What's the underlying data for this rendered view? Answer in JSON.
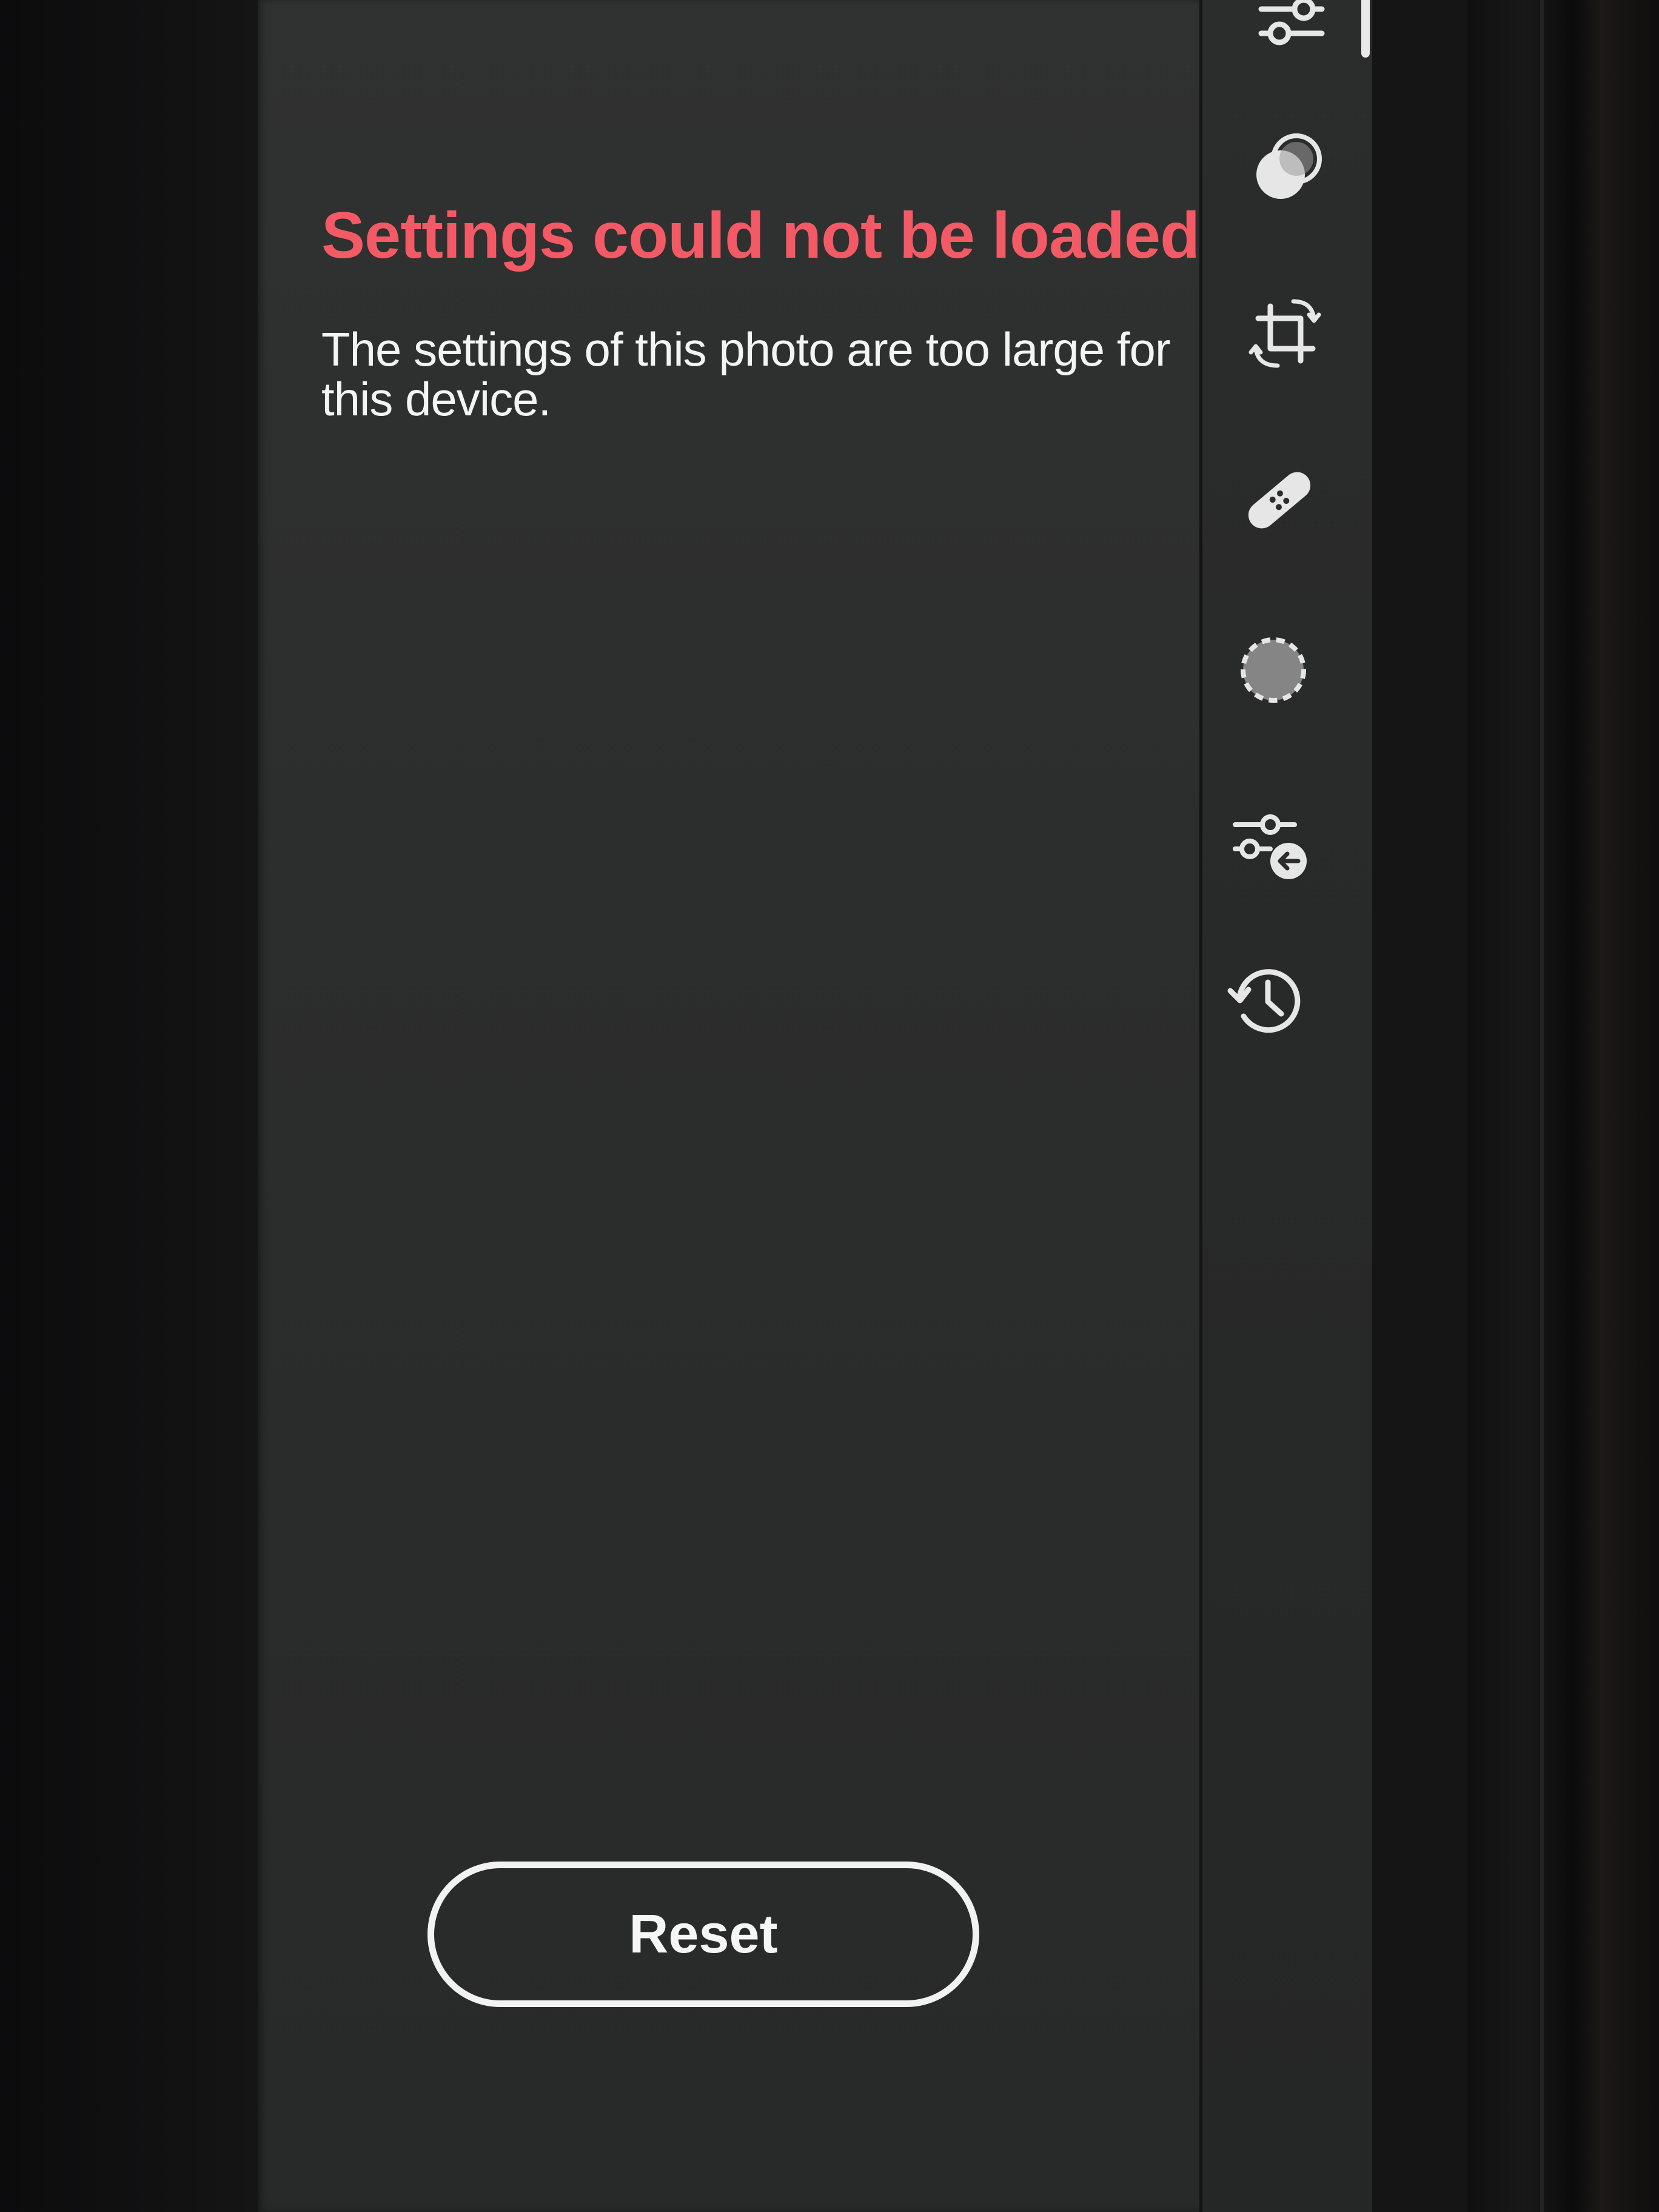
{
  "error": {
    "title": "Settings could not be loaded",
    "message": "The settings of this photo are too large for this device."
  },
  "actions": {
    "reset_label": "Reset"
  },
  "toolbar": {
    "tools": [
      {
        "icon": "edit-sliders-icon"
      },
      {
        "icon": "presets-icon"
      },
      {
        "icon": "crop-rotate-icon"
      },
      {
        "icon": "healing-icon"
      },
      {
        "icon": "masking-icon"
      },
      {
        "icon": "adjustment-reset-icon"
      },
      {
        "icon": "history-icon"
      }
    ]
  },
  "colors": {
    "error_title": "#f35a66",
    "panel_background": "#2c2d2d",
    "text": "#f4f4f4"
  }
}
